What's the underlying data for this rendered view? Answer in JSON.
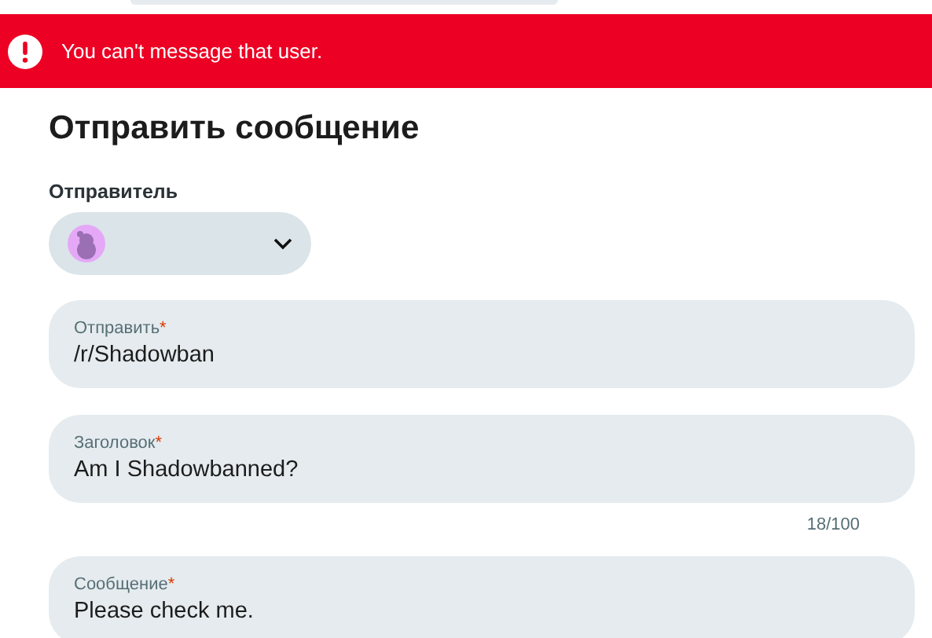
{
  "alert": {
    "message": "You can't message that user."
  },
  "form": {
    "title": "Отправить сообщение",
    "sender": {
      "label": "Отправитель"
    },
    "fields": [
      {
        "label": "Отправить",
        "required_mark": "*",
        "value": "/r/Shadowban"
      },
      {
        "label": "Заголовок",
        "required_mark": "*",
        "value": "Am I Shadowbanned?",
        "counter": "18/100"
      },
      {
        "label": "Сообщение",
        "required_mark": "*",
        "value": "Please check me."
      }
    ]
  }
}
